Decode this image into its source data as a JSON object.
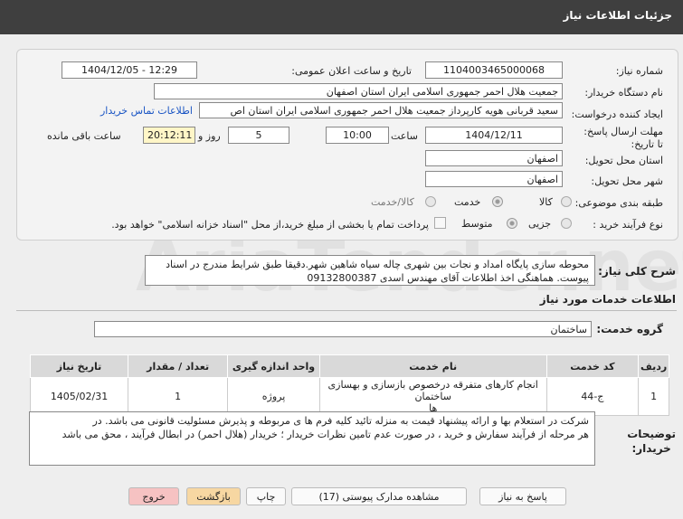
{
  "header": {
    "title": "جزئیات اطلاعات نیاز"
  },
  "form": {
    "need_number_label": "شماره نیاز:",
    "need_number": "1104003465000068",
    "announce_label": "تاریخ و ساعت اعلان عمومی:",
    "announce_value": "1404/12/05 - 12:29",
    "buyer_label": "نام دستگاه خریدار:",
    "buyer_value": "جمعیت هلال احمر جمهوری اسلامی ایران استان اصفهان",
    "creator_label": "ایجاد کننده درخواست:",
    "creator_value": "سعید قربانی هویه کارپرداز جمعیت هلال احمر جمهوری اسلامی ایران استان اص",
    "contact_link": "اطلاعات تماس خریدار",
    "deadline_label": "مهلت ارسال پاسخ: تا تاریخ:",
    "deadline_date": "1404/12/11",
    "time_label": "ساعت",
    "deadline_time": "10:00",
    "days_value": "5",
    "days_label": "روز و",
    "remaining_time": "20:12:11",
    "remaining_label": "ساعت باقی مانده",
    "province_label": "استان محل تحویل:",
    "province_value": "اصفهان",
    "city_label": "شهر محل تحویل:",
    "city_value": "اصفهان",
    "category_label": "طبقه بندی موضوعی:",
    "category_options": [
      "کالا",
      "خدمت",
      "کالا/خدمت"
    ],
    "process_label": "نوع فرآیند خرید :",
    "process_options": [
      "جزیی",
      "متوسط"
    ],
    "payment_note": "پرداخت تمام یا بخشی از مبلغ خرید،از محل \"اسناد خزانه اسلامی\" خواهد بود."
  },
  "summary": {
    "label": "شرح کلی نیاز:",
    "text_line1": "محوطه سازی پایگاه امداد و نجات بین شهری چاله سیاه شاهین شهر.دقیقا طبق شرایط مندرج در اسناد",
    "text_line2": "پیوست. هماهنگی اخذ اطلاعات آقای مهندس اسدی 09132800387"
  },
  "services": {
    "section_title": "اطلاعات خدمات مورد نیاز",
    "group_label": "گروه خدمت:",
    "group_value": "ساختمان",
    "columns": [
      "ردیف",
      "کد خدمت",
      "نام خدمت",
      "واحد اندازه گیری",
      "تعداد / مقدار",
      "تاریخ نیاز"
    ],
    "rows": [
      {
        "row": "1",
        "code": "ج-44",
        "name_line1": "انجام کارهای متفرقه درخصوص بازسازی و بهسازی ساختمان",
        "name_line2": "ها",
        "unit": "پروژه",
        "qty": "1",
        "date": "1405/02/31"
      }
    ]
  },
  "notes": {
    "label_line1": "توضیحات",
    "label_line2": "خریدار:",
    "text_line1": "شرکت در استعلام بها و ارائه پیشنهاد قیمت به منزله تائید کلیه فرم ها ی  مربوطه و پذیرش مسئولیت قانونی می باشد.  در",
    "text_line2": "هر مرحله از فرآیند سفارش و خرید ، در صورت عدم تامین نظرات خریدار ؛ خریدار (هلال احمر) در ابطال فرآیند ، محق می باشد"
  },
  "buttons": {
    "reply": "پاسخ به نیاز",
    "view_docs": "مشاهده مدارک پیوستی (17)",
    "print": "چاپ",
    "back": "بازگشت",
    "exit": "خروج"
  },
  "watermark": "AriaTender.net"
}
